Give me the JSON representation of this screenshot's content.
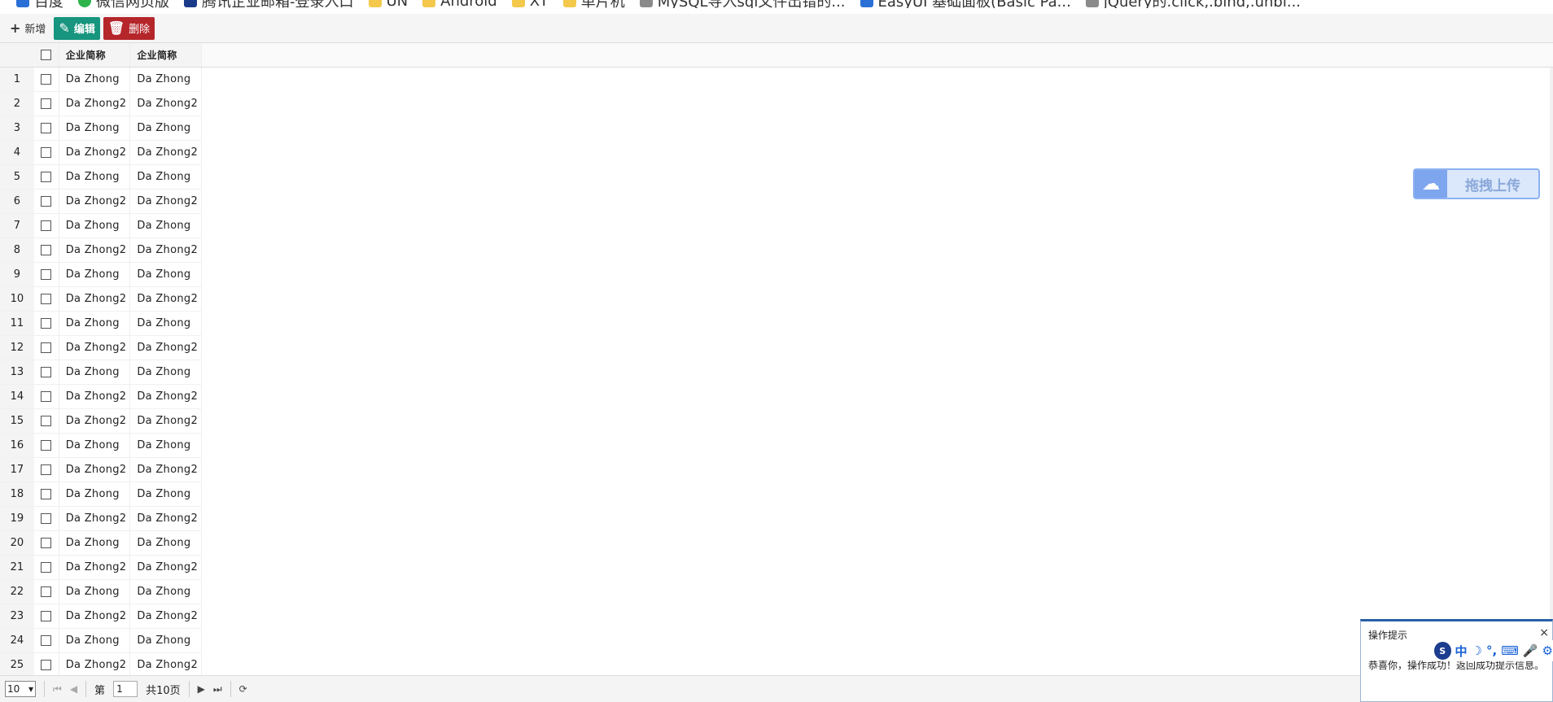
{
  "bookmarks": [
    {
      "label": "百度",
      "icon": "baidu-icon"
    },
    {
      "label": "微信网页版",
      "icon": "wechat-icon"
    },
    {
      "label": "腾讯企业邮箱-登录入口",
      "icon": "tencent-mail-icon"
    },
    {
      "label": "UN",
      "icon": "folder-icon"
    },
    {
      "label": "Android",
      "icon": "folder-icon"
    },
    {
      "label": "XT",
      "icon": "folder-icon"
    },
    {
      "label": "单片机",
      "icon": "folder-icon"
    },
    {
      "label": "MySQL导入sql文件出错的...",
      "icon": "page-icon"
    },
    {
      "label": "EasyUI 基础面板(Basic Pa...",
      "icon": "ie-icon"
    },
    {
      "label": "jQuery的.click,.bind,.unbi...",
      "icon": "page-icon"
    }
  ],
  "toolbar": {
    "add_label": "新增",
    "edit_label": "编辑",
    "delete_label": "删除"
  },
  "grid": {
    "columns": [
      "企业简称",
      "企业简称"
    ],
    "rows": [
      {
        "num": "1",
        "a": "Da Zhong",
        "b": "Da Zhong"
      },
      {
        "num": "2",
        "a": "Da Zhong2",
        "b": "Da Zhong2"
      },
      {
        "num": "3",
        "a": "Da Zhong",
        "b": "Da Zhong"
      },
      {
        "num": "4",
        "a": "Da Zhong2",
        "b": "Da Zhong2"
      },
      {
        "num": "5",
        "a": "Da Zhong",
        "b": "Da Zhong"
      },
      {
        "num": "6",
        "a": "Da Zhong2",
        "b": "Da Zhong2"
      },
      {
        "num": "7",
        "a": "Da Zhong",
        "b": "Da Zhong"
      },
      {
        "num": "8",
        "a": "Da Zhong2",
        "b": "Da Zhong2"
      },
      {
        "num": "9",
        "a": "Da Zhong",
        "b": "Da Zhong"
      },
      {
        "num": "10",
        "a": "Da Zhong2",
        "b": "Da Zhong2"
      },
      {
        "num": "11",
        "a": "Da Zhong",
        "b": "Da Zhong"
      },
      {
        "num": "12",
        "a": "Da Zhong2",
        "b": "Da Zhong2"
      },
      {
        "num": "13",
        "a": "Da Zhong",
        "b": "Da Zhong"
      },
      {
        "num": "14",
        "a": "Da Zhong2",
        "b": "Da Zhong2"
      },
      {
        "num": "15",
        "a": "Da Zhong2",
        "b": "Da Zhong2"
      },
      {
        "num": "16",
        "a": "Da Zhong",
        "b": "Da Zhong"
      },
      {
        "num": "17",
        "a": "Da Zhong2",
        "b": "Da Zhong2"
      },
      {
        "num": "18",
        "a": "Da Zhong",
        "b": "Da Zhong"
      },
      {
        "num": "19",
        "a": "Da Zhong2",
        "b": "Da Zhong2"
      },
      {
        "num": "20",
        "a": "Da Zhong",
        "b": "Da Zhong"
      },
      {
        "num": "21",
        "a": "Da Zhong2",
        "b": "Da Zhong2"
      },
      {
        "num": "22",
        "a": "Da Zhong",
        "b": "Da Zhong"
      },
      {
        "num": "23",
        "a": "Da Zhong2",
        "b": "Da Zhong2"
      },
      {
        "num": "24",
        "a": "Da Zhong",
        "b": "Da Zhong"
      },
      {
        "num": "25",
        "a": "Da Zhong2",
        "b": "Da Zhong2"
      }
    ]
  },
  "pager": {
    "page_size": "10",
    "page_prefix": "第",
    "current_page": "1",
    "total_label": "共10页"
  },
  "upload": {
    "label": "拖拽上传"
  },
  "toast": {
    "title": "操作提示",
    "close": "×",
    "message": "恭喜你，操作成功！返回成功提示信息。"
  },
  "ime": {
    "mode": "中"
  }
}
